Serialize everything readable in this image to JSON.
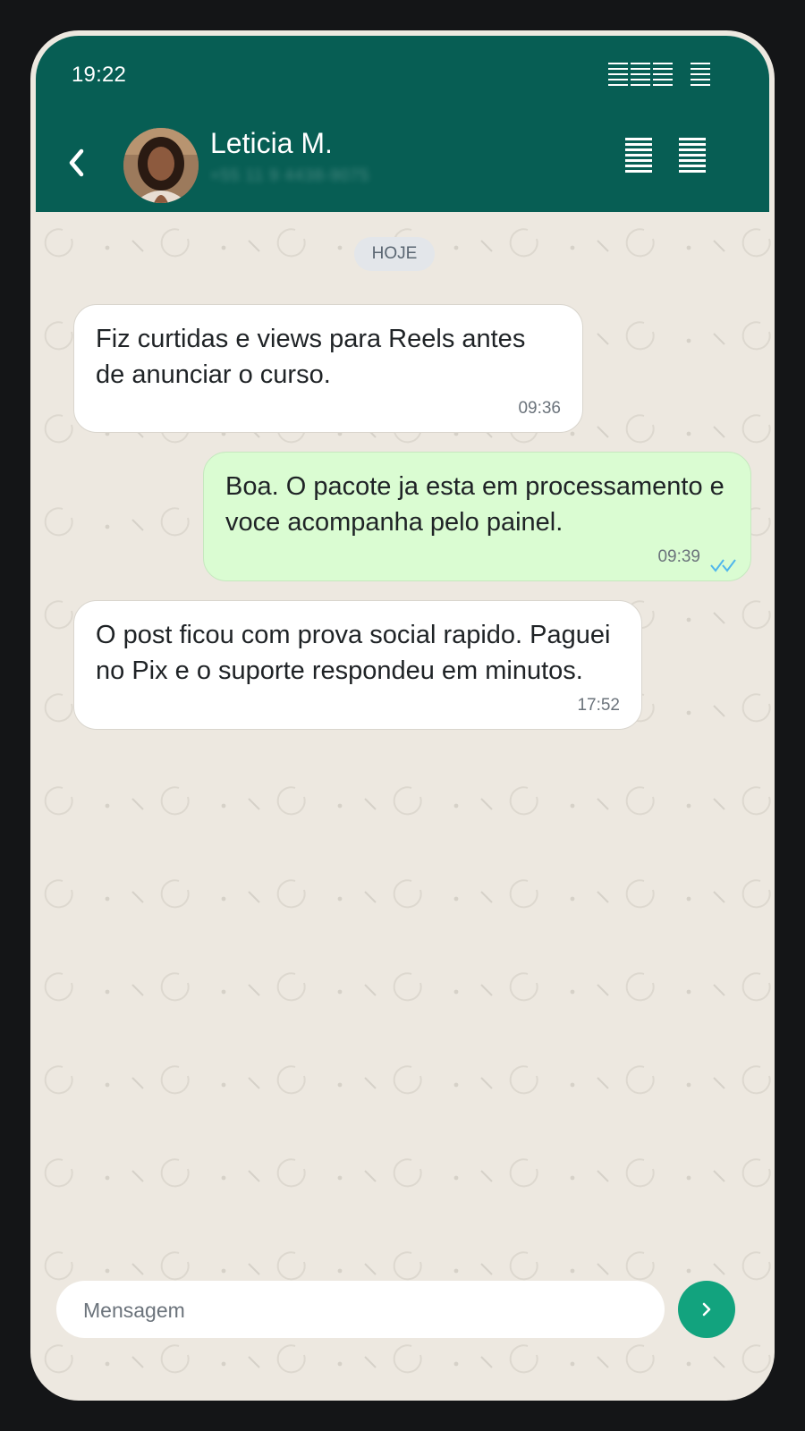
{
  "status_bar": {
    "time": "19:22"
  },
  "header": {
    "contact_name": "Leticia M.",
    "contact_phone": "+55 11 9 4438-9075",
    "back_icon": "chevron-left-icon",
    "call_icon": "call-icon",
    "menu_icon": "menu-icon"
  },
  "chat": {
    "day_label": "HOJE",
    "messages": [
      {
        "direction": "in",
        "text": "Fiz curtidas e views para Reels antes de anunciar o curso.",
        "time": "09:36"
      },
      {
        "direction": "out",
        "text": "Boa. O pacote ja esta em processamento e voce acompanha pelo painel.",
        "time": "09:39",
        "status": "read"
      },
      {
        "direction": "in",
        "text": "O post ficou com prova social rapido. Paguei no Pix e o suporte respondeu em minutos.",
        "time": "17:52"
      }
    ]
  },
  "composer": {
    "placeholder": "Mensagem",
    "value": "",
    "send_icon": "chevron-right-icon"
  },
  "colors": {
    "header": "#075e54",
    "chat_background": "#ede8e0",
    "incoming_bubble": "#ffffff",
    "outgoing_bubble": "#dafcd2",
    "send_button": "#12a37e",
    "read_ticks": "#4fb6ec"
  }
}
